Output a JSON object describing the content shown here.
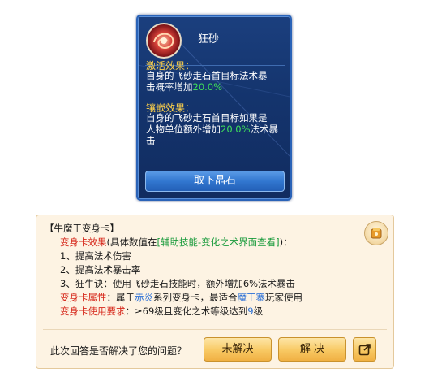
{
  "gem_tooltip": {
    "name": "狂砂",
    "activate_title": "激活效果：",
    "activate_text_1": "自身的飞砂走石首目标法术暴",
    "activate_text_2_prefix": "击概率增加",
    "activate_value": "20.0%",
    "inlay_title": "镶嵌效果：",
    "inlay_text_1": "自身的飞砂走石首目标如果是",
    "inlay_text_2_prefix": "人物单位额外增加",
    "inlay_value": "20.0%",
    "inlay_text_2_suffix": "法术暴",
    "inlay_text_3": "击",
    "button_label": "取下晶石"
  },
  "answer": {
    "title": "【牛魔王变身卡】",
    "effect_label": "变身卡效果",
    "effect_paren_open": "(具体数值在",
    "effect_link": "[辅助技能-变化之术界面查看]",
    "effect_paren_close": ")：",
    "item1": "1、提高法术伤害",
    "item2": "2、提高法术暴击率",
    "item3": "3、狂牛诀：使用飞砂走石技能时，额外增加6%法术暴击",
    "attr_label": "变身卡属性",
    "attr_text_1": "：属于",
    "attr_chiyan": "赤炎",
    "attr_text_2": "系列变身卡，最适合",
    "attr_mowangzhai": "魔王寨",
    "attr_text_3": "玩家使用",
    "req_label": "变身卡使用要求",
    "req_text_1": "：≥69级且变化之术等级达到",
    "req_level": "9",
    "req_text_2": "级",
    "question": "此次回答是否解决了您的问题？",
    "btn_unsolved": "未解决",
    "btn_solved": "解 决"
  },
  "colors": {
    "panel_blue": "#14346d",
    "section_yellow": "#ffd24a",
    "value_green": "#3fe05a",
    "label_red": "#d6281b",
    "link_green": "#179a3a",
    "link_blue": "#2a6fd6",
    "card_bg": "#fdf3e3",
    "button_gold": "#f8c862"
  },
  "icons": {
    "gem": "red-swirl-gem-icon",
    "badge": "wallet-badge-icon",
    "share": "share-external-icon"
  }
}
